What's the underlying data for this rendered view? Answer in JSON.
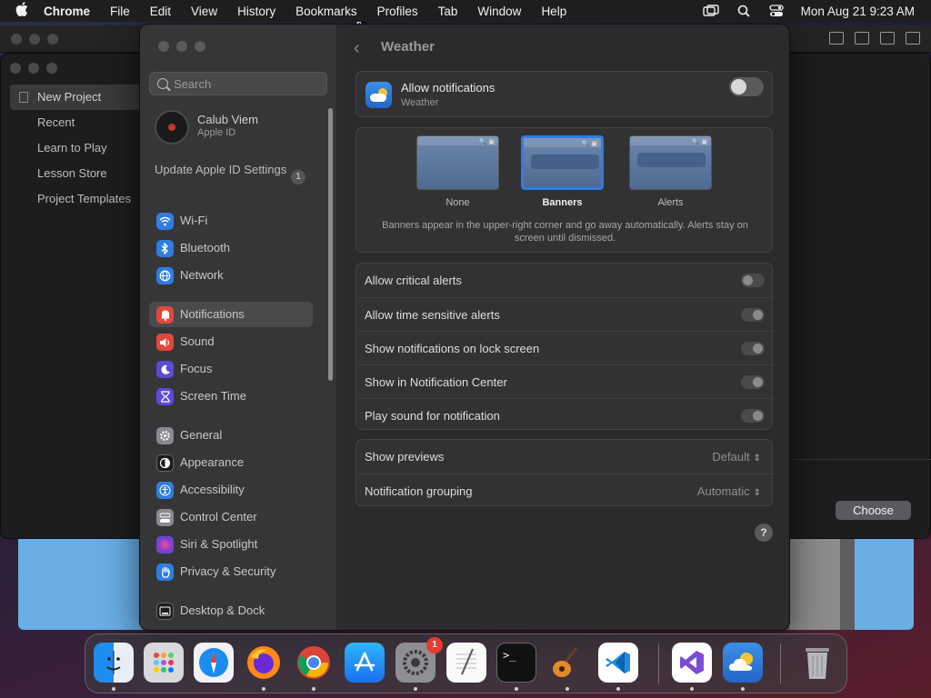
{
  "menubar": {
    "app_name": "Chrome",
    "items": [
      "File",
      "Edit",
      "View",
      "History",
      "Bookmarks",
      "Profiles",
      "Tab",
      "Window",
      "Help"
    ],
    "clock": "Mon Aug 21  9:23 AM"
  },
  "background_app": {
    "sidebar_items": [
      "New Project",
      "Recent",
      "Learn to Play",
      "Lesson Store",
      "Project Templates"
    ],
    "choose_label": "Choose"
  },
  "settings": {
    "search_placeholder": "Search",
    "account": {
      "name": "Calub Viem",
      "sub": "Apple ID"
    },
    "update": {
      "label": "Update Apple ID Settings",
      "badge": "1"
    },
    "nav": [
      {
        "label": "Wi-Fi",
        "icon": "wifi-icon",
        "color": "#2f7de1"
      },
      {
        "label": "Bluetooth",
        "icon": "bluetooth-icon",
        "color": "#2f7de1"
      },
      {
        "label": "Network",
        "icon": "globe-icon",
        "color": "#2f7de1"
      },
      {
        "label": "Notifications",
        "icon": "bell-icon",
        "color": "#e5463a"
      },
      {
        "label": "Sound",
        "icon": "speaker-icon",
        "color": "#e5463a"
      },
      {
        "label": "Focus",
        "icon": "moon-icon",
        "color": "#5b4bd6"
      },
      {
        "label": "Screen Time",
        "icon": "hourglass-icon",
        "color": "#5b4bd6"
      },
      {
        "label": "General",
        "icon": "gear-icon",
        "color": "#8a8a8e"
      },
      {
        "label": "Appearance",
        "icon": "appearance-icon",
        "color": "#1c1c1e"
      },
      {
        "label": "Accessibility",
        "icon": "accessibility-icon",
        "color": "#2f7de1"
      },
      {
        "label": "Control Center",
        "icon": "control-center-icon",
        "color": "#8a8a8e"
      },
      {
        "label": "Siri & Spotlight",
        "icon": "siri-icon",
        "color": "#b04bd6"
      },
      {
        "label": "Privacy & Security",
        "icon": "hand-icon",
        "color": "#2f7de1"
      },
      {
        "label": "Desktop & Dock",
        "icon": "dock-icon",
        "color": "#1c1c1e"
      }
    ],
    "selected_nav": "Notifications",
    "pane_title": "Weather",
    "allow_notifications": {
      "title": "Allow notifications",
      "sub": "Weather",
      "enabled": false
    },
    "alert_styles": {
      "options": [
        "None",
        "Banners",
        "Alerts"
      ],
      "selected": "Banners",
      "description": "Banners appear in the upper-right corner and go away automatically. Alerts stay on screen until dismissed."
    },
    "toggles": [
      {
        "label": "Allow critical alerts",
        "on": false
      },
      {
        "label": "Allow time sensitive alerts",
        "on": false
      },
      {
        "label": "Show notifications on lock screen",
        "on": false
      },
      {
        "label": "Show in Notification Center",
        "on": false
      },
      {
        "label": "Play sound for notification",
        "on": false
      }
    ],
    "popups": [
      {
        "label": "Show previews",
        "value": "Default"
      },
      {
        "label": "Notification grouping",
        "value": "Automatic"
      }
    ],
    "help": "?"
  },
  "dock": {
    "apps": [
      "Finder",
      "Launchpad",
      "Safari",
      "Firefox",
      "Chrome",
      "App Store",
      "System Settings",
      "TextEdit",
      "Terminal",
      "GarageBand",
      "Visual Studio Code",
      "Visual Studio",
      "Weather",
      "Trash"
    ],
    "settings_badge": "1"
  },
  "colors": {
    "accent": "#2f7de1",
    "window_bg": "#2b2b2d",
    "sidebar_bg": "#363638"
  }
}
